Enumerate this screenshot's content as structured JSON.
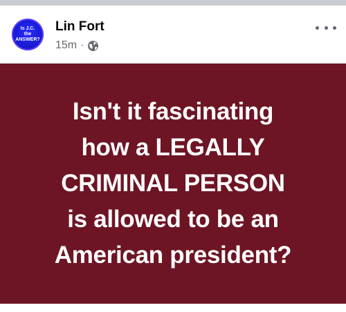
{
  "post": {
    "author": "Lin Fort",
    "timestamp": "15m",
    "separator": "·",
    "audience_icon": "globe-icon",
    "more_icon": "more-options-icon",
    "avatar_text": [
      "Is J.C.",
      "the",
      "ANSWER?"
    ],
    "body_lines": [
      "Isn't it fascinating",
      "how a  LEGALLY",
      "CRIMINAL PERSON",
      "is allowed to be an",
      "American president?"
    ],
    "background_color": "#6d1524",
    "text_color": "#ffffff"
  }
}
